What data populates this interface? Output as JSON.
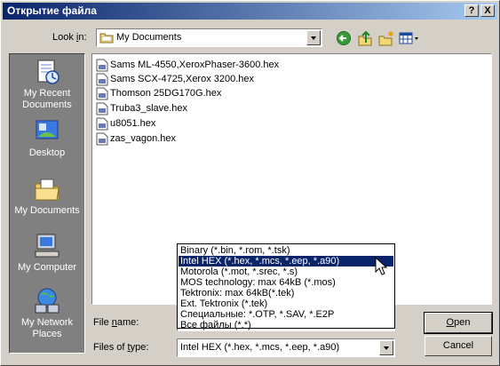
{
  "window": {
    "title": "Открытие файла",
    "help_btn": "?",
    "close_btn": "X"
  },
  "lookin": {
    "label_prefix": "Look ",
    "label_accel": "i",
    "label_suffix": "n:",
    "value": "My Documents"
  },
  "toolbar": {
    "icons": [
      "back-icon",
      "up-folder-icon",
      "new-folder-icon",
      "view-menu-icon"
    ]
  },
  "places": [
    {
      "label": "My Recent Documents",
      "icon": "recent-documents-icon"
    },
    {
      "label": "Desktop",
      "icon": "desktop-icon"
    },
    {
      "label": "My Documents",
      "icon": "my-documents-icon"
    },
    {
      "label": "My Computer",
      "icon": "my-computer-icon"
    },
    {
      "label": "My Network Places",
      "icon": "network-places-icon"
    }
  ],
  "files": [
    "Sams ML-4550,XeroxPhaser-3600.hex",
    "Sams SCX-4725,Xerox 3200.hex",
    "Thomson 25DG170G.hex",
    "Truba3_slave.hex",
    "u8051.hex",
    "zas_vagon.hex"
  ],
  "filename": {
    "label_prefix": "File ",
    "label_accel": "n",
    "label_suffix": "ame:",
    "value": ""
  },
  "filetype": {
    "label_prefix": "Files of ",
    "label_accel": "t",
    "label_suffix": "ype:",
    "value": "Intel HEX (*.hex, *.mcs, *.eep, *.a90)",
    "options": [
      "Binary (*.bin, *.rom, *.tsk)",
      "Intel HEX (*.hex, *.mcs, *.eep, *.a90)",
      "Motorola (*.mot, *.srec, *.s)",
      "MOS technology: max 64kB (*.mos)",
      "Tektronix: max 64kB(*.tek)",
      "Ext. Tektronix (*.tek)",
      "Специальные: *.OTP, *.SAV, *.E2P",
      "Все файлы (*.*)"
    ],
    "selected_index": 1
  },
  "buttons": {
    "open_accel": "O",
    "open_rest": "pen",
    "cancel": "Cancel"
  },
  "colors": {
    "titlebar_start": "#0a246a",
    "titlebar_end": "#a6caf0",
    "selection": "#0a246a",
    "places_bg": "#808080",
    "face": "#d4d0c8"
  }
}
